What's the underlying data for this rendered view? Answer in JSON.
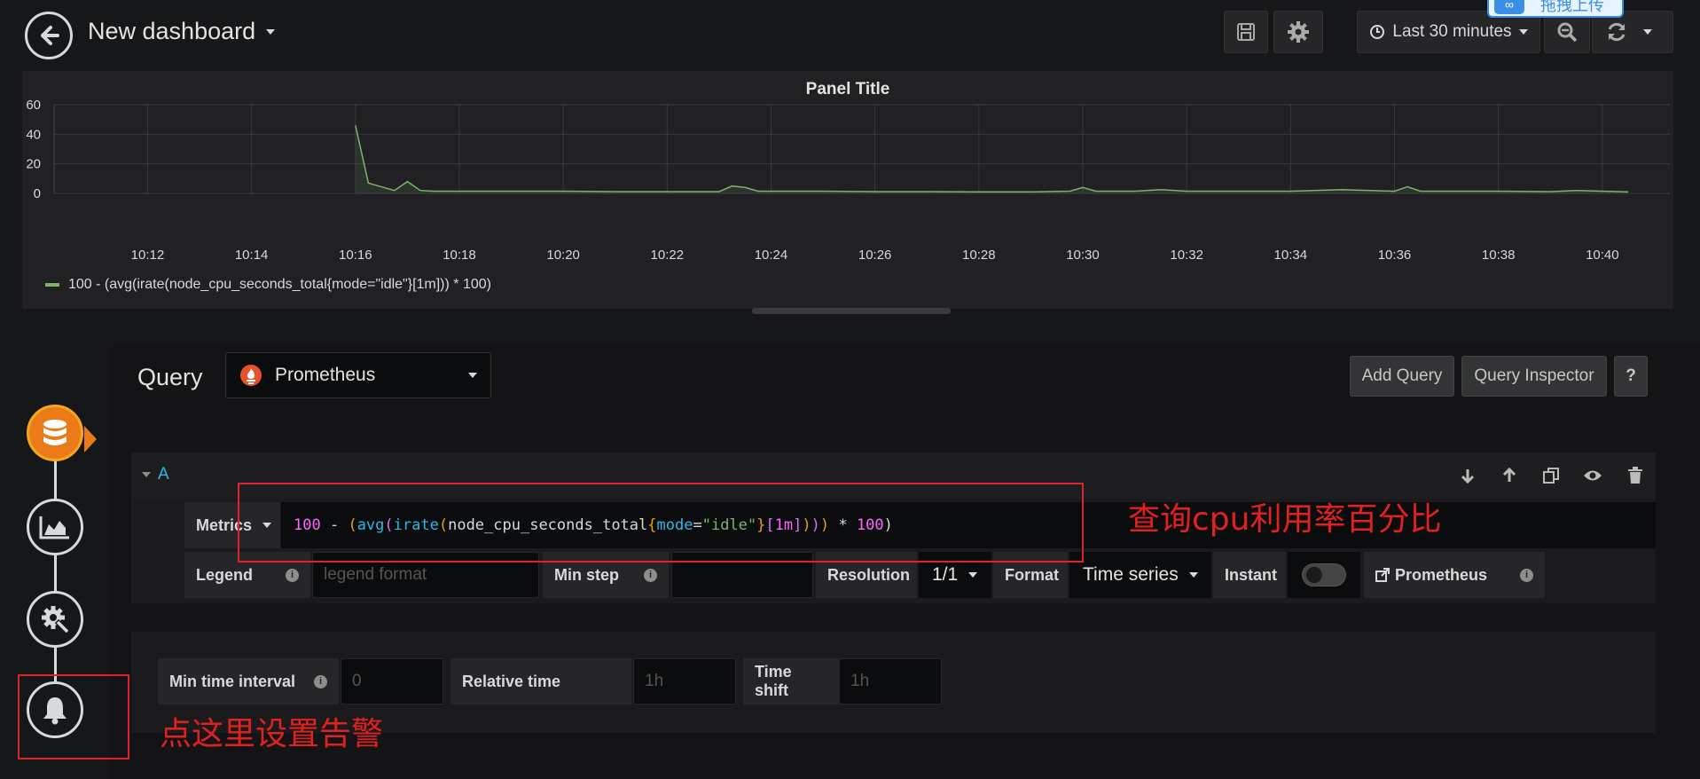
{
  "header": {
    "title": "New dashboard",
    "time_range": "Last 30 minutes",
    "upload_badge": "拖拽上传",
    "upload_logo": "∞"
  },
  "panel": {
    "title": "Panel Title",
    "legend": "100 - (avg(irate(node_cpu_seconds_total{mode=\"idle\"}[1m])) * 100)",
    "series_color": "#7eb26d"
  },
  "chart_data": {
    "type": "line",
    "title": "Panel Title",
    "xlabel": "",
    "ylabel": "",
    "ylim": [
      0,
      60
    ],
    "yticks": [
      "60",
      "40",
      "20",
      "0"
    ],
    "xticks": [
      "10:12",
      "10:14",
      "10:16",
      "10:18",
      "10:20",
      "10:22",
      "10:24",
      "10:26",
      "10:28",
      "10:30",
      "10:32",
      "10:34",
      "10:36",
      "10:38",
      "10:40"
    ],
    "grid": true,
    "legend_position": "bottom-left",
    "series": [
      {
        "name": "100 - (avg(irate(node_cpu_seconds_total{mode=\"idle\"}[1m])) * 100)",
        "x": [
          "10:16",
          "10:16:15",
          "10:16:45",
          "10:17",
          "10:17:15",
          "10:17:30",
          "10:18",
          "10:19",
          "10:20",
          "10:21",
          "10:22",
          "10:23",
          "10:23:15",
          "10:23:30",
          "10:23:45",
          "10:24",
          "10:25",
          "10:26",
          "10:27",
          "10:28",
          "10:29",
          "10:29:45",
          "10:30",
          "10:30:15",
          "10:31",
          "10:31:30",
          "10:32",
          "10:33",
          "10:34",
          "10:35",
          "10:36",
          "10:36:15",
          "10:36:30",
          "10:37",
          "10:38",
          "10:39",
          "10:39:30",
          "10:40",
          "10:40:30"
        ],
        "values": [
          46,
          7,
          2,
          8,
          2,
          1.5,
          1.5,
          1.5,
          1.5,
          1.2,
          1.2,
          1.2,
          5,
          4,
          1.5,
          1.5,
          1.5,
          1.2,
          1.2,
          1,
          1,
          1.5,
          4,
          1.5,
          1.5,
          2.5,
          1.5,
          1.5,
          1.5,
          2.5,
          1.5,
          4.5,
          1.5,
          1.5,
          1.5,
          1.2,
          2,
          1.5,
          1
        ]
      }
    ]
  },
  "query_editor": {
    "label": "Query",
    "datasource": "Prometheus",
    "add_query": "Add Query",
    "query_inspector": "Query Inspector",
    "help": "?",
    "row": {
      "letter": "A",
      "metrics_label": "Metrics",
      "expr_parts": [
        {
          "t": "100",
          "c": "#ff66ff"
        },
        {
          "t": " - ",
          "c": "#d8d9da"
        },
        {
          "t": "(",
          "c": "#e5a00d"
        },
        {
          "t": "avg",
          "c": "#33b5e5"
        },
        {
          "t": "(",
          "c": "#d670ff"
        },
        {
          "t": "irate",
          "c": "#33b5e5"
        },
        {
          "t": "(",
          "c": "#e5a00d"
        },
        {
          "t": "node_cpu_seconds_total",
          "c": "#d8d9da"
        },
        {
          "t": "{",
          "c": "#e5a00d"
        },
        {
          "t": "mode",
          "c": "#33b5e5"
        },
        {
          "t": "=",
          "c": "#d8d9da"
        },
        {
          "t": "\"idle\"",
          "c": "#7eb26d"
        },
        {
          "t": "}",
          "c": "#e5a00d"
        },
        {
          "t": "[",
          "c": "#d670ff"
        },
        {
          "t": "1m",
          "c": "#ff66ff"
        },
        {
          "t": "]",
          "c": "#d670ff"
        },
        {
          "t": ")",
          "c": "#e5a00d"
        },
        {
          "t": ")",
          "c": "#d670ff"
        },
        {
          "t": ")",
          "c": "#e5a00d"
        },
        {
          "t": " * ",
          "c": "#d8d9da"
        },
        {
          "t": "100",
          "c": "#ff66ff"
        },
        {
          "t": ")",
          "c": "#d8d9da"
        }
      ],
      "legend_label": "Legend",
      "legend_placeholder": "legend format",
      "min_step_label": "Min step",
      "resolution_label": "Resolution",
      "resolution_value": "1/1",
      "format_label": "Format",
      "format_value": "Time series",
      "instant_label": "Instant",
      "prometheus_link": "Prometheus"
    },
    "options": {
      "min_time_interval_label": "Min time interval",
      "min_time_interval_placeholder": "0",
      "relative_time_label": "Relative time",
      "relative_time_placeholder": "1h",
      "time_shift_label": "Time shift",
      "time_shift_placeholder": "1h"
    }
  },
  "annotations": {
    "query_note": "查询cpu利用率百分比",
    "alert_note": "点这里设置告警",
    "color": "#e0211e"
  }
}
